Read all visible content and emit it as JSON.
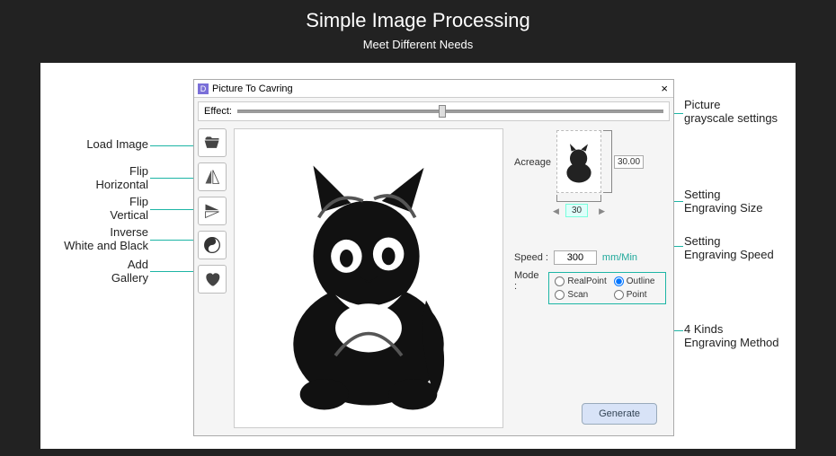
{
  "header": {
    "title": "Simple Image Processing",
    "subtitle": "Meet Different Needs"
  },
  "window": {
    "title": "Picture To Cavring",
    "close": "×"
  },
  "effect": {
    "label": "Effect:"
  },
  "toolbar": {
    "load": "Load Image",
    "flip_h": "Flip Horizontal",
    "flip_v": "Flip Vertical",
    "inverse": "Inverse White and Black",
    "gallery": "Add Gallery"
  },
  "acreage": {
    "label": "Acreage",
    "height": "30.00",
    "width": "30"
  },
  "speed": {
    "label": "Speed :",
    "value": "300",
    "unit": "mm/Min"
  },
  "mode": {
    "label": "Mode :",
    "options": {
      "realpoint": "RealPoint",
      "outline": "Outline",
      "scan": "Scan",
      "point": "Point"
    }
  },
  "generate": {
    "label": "Generate"
  },
  "callouts": {
    "load": "Load Image",
    "flip_h": "Flip\nHorizontal",
    "flip_v": "Flip\nVertical",
    "inverse": "Inverse\nWhite and Black",
    "gallery": "Add\nGallery",
    "grayscale": "Picture\ngrayscale settings",
    "size": "Setting\nEngraving Size",
    "speed": "Setting\nEngraving Speed",
    "method": "4 Kinds\nEngraving Method"
  }
}
